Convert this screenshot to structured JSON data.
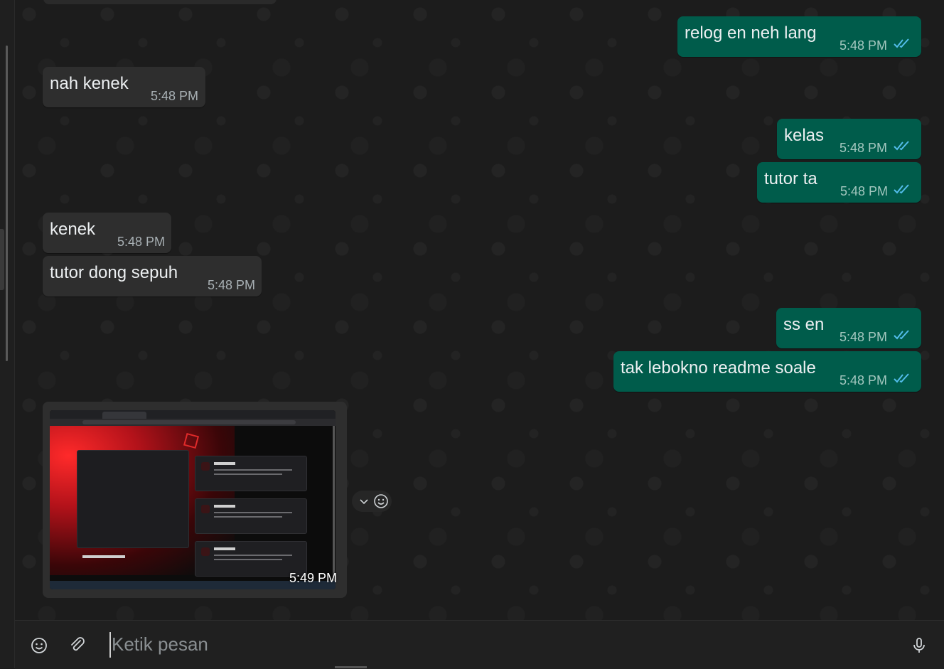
{
  "messages": [
    {
      "dir": "out",
      "text": "relog en neh lang",
      "time": "5:48 PM",
      "read": true
    },
    {
      "dir": "in",
      "text": "nah kenek",
      "time": "5:48 PM"
    },
    {
      "dir": "out",
      "text": "kelas",
      "time": "5:48 PM",
      "read": true
    },
    {
      "dir": "out",
      "text": "tutor ta",
      "time": "5:48 PM",
      "read": true
    },
    {
      "dir": "in",
      "text": "kenek",
      "time": "5:48 PM"
    },
    {
      "dir": "in",
      "text": "tutor dong sepuh",
      "time": "5:48 PM"
    },
    {
      "dir": "out",
      "text": "ss en",
      "time": "5:48 PM",
      "read": true
    },
    {
      "dir": "out",
      "text": "tak lebokno readme soale",
      "time": "5:48 PM",
      "read": true
    }
  ],
  "image_message": {
    "dir": "in",
    "time": "5:49 PM"
  },
  "composer": {
    "placeholder": "Ketik pesan"
  },
  "colors": {
    "bubble_in": "#2e2e2e",
    "bubble_out": "#005c4b",
    "read_ticks": "#53bdeb",
    "background": "#1c1c1c"
  },
  "icons": {
    "emoji": "emoji-icon",
    "attach": "paperclip-icon",
    "mic": "microphone-icon",
    "react": "smiley-icon",
    "menu": "chevron-down-icon",
    "read": "double-check-icon"
  }
}
